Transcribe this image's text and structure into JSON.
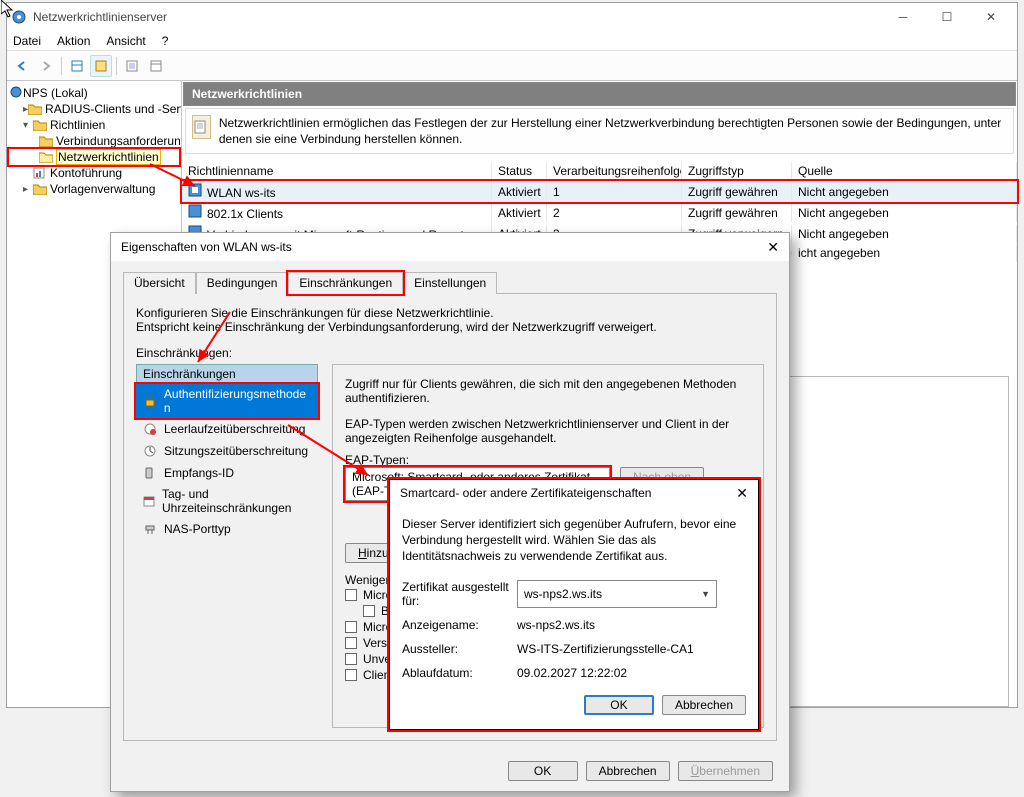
{
  "main": {
    "title": "Netzwerkrichtlinienserver",
    "menu": {
      "file": "Datei",
      "action": "Aktion",
      "view": "Ansicht",
      "help": "?"
    },
    "tree": {
      "root": "NPS (Lokal)",
      "radius": "RADIUS-Clients und -Serve",
      "policies": "Richtlinien",
      "conn_req": "Verbindungsanforderun",
      "net_pol": "Netzwerkrichtlinien",
      "accounting": "Kontoführung",
      "templates": "Vorlagenverwaltung"
    },
    "detail": {
      "heading": "Netzwerkrichtlinien",
      "desc": "Netzwerkrichtlinien ermöglichen das Festlegen der zur Herstellung einer Netzwerkverbindung berechtigten Personen sowie der Bedingungen, unter denen sie eine Verbindung herstellen können.",
      "cols": {
        "name": "Richtlinienname",
        "status": "Status",
        "order": "Verarbeitungsreihenfolge",
        "access": "Zugriffstyp",
        "source": "Quelle"
      },
      "rows": [
        {
          "name": "WLAN ws-its",
          "status": "Aktiviert",
          "order": "1",
          "access": "Zugriff gewähren",
          "source": "Nicht angegeben"
        },
        {
          "name": "802.1x Clients",
          "status": "Aktiviert",
          "order": "2",
          "access": "Zugriff gewähren",
          "source": "Nicht angegeben"
        },
        {
          "name": "Verbindungen mit Microsoft-Routing- und Remotezugriffsserver",
          "status": "Aktiviert",
          "order": "3",
          "access": "Zugriff verweigern",
          "source": "Nicht angegeben"
        },
        {
          "name": "",
          "status": "",
          "order": "",
          "access": "",
          "source": "icht angegeben"
        }
      ]
    }
  },
  "props": {
    "title": "Eigenschaften von WLAN ws-its",
    "tabs": {
      "overview": "Übersicht",
      "conditions": "Bedingungen",
      "constraints": "Einschränkungen",
      "settings": "Einstellungen"
    },
    "conf1": "Konfigurieren Sie die Einschränkungen für diese Netzwerkrichtlinie.",
    "conf2": "Entspricht keine Einschränkung der Verbindungsanforderung, wird der Netzwerkzugriff verweigert.",
    "constraints_lbl": "Einschränkungen:",
    "group_hdr": "Einschränkungen",
    "items": {
      "auth": "Authentifizierungsmethoden",
      "idle": "Leerlaufzeitüberschreitung",
      "sess": "Sitzungszeitüberschreitung",
      "called": "Empfangs-ID",
      "day": "Tag- und Uhrzeiteinschränkungen",
      "nas": "NAS-Porttyp"
    },
    "right": {
      "t1": "Zugriff nur für Clients gewähren, die sich mit den angegebenen Methoden authentifizieren.",
      "t2": "EAP-Typen werden zwischen Netzwerkrichtlinienserver und Client in der angezeigten Reihenfolge ausgehandelt.",
      "eap_lbl": "EAP-Typen:",
      "eap_sel": "Microsoft: Smartcard- oder anderes Zertifikat (EAP-TLS)",
      "up": "Nach oben",
      "add": "Hinzufügen",
      "less": "Weniger siche",
      "chk_mschap2": "Microsoft-/",
      "chk_mschap2b": "Benutze",
      "chk_mschap": "Microsoft-/",
      "chk_enc": "Verschlüss",
      "chk_unenc": "Unverschl",
      "chk_client": "Clientverb"
    },
    "ok": "OK",
    "cancel": "Abbrechen",
    "apply": "Übernehmen"
  },
  "cert": {
    "title": "Smartcard- oder andere Zertifikateigenschaften",
    "desc": "Dieser Server identifiziert sich gegenüber Aufrufern, bevor eine Verbindung hergestellt wird. Wählen Sie das als Identitätsnachweis zu verwendende Zertifikat aus.",
    "issued_to_lbl": "Zertifikat ausgestellt für:",
    "issued_to": "ws-nps2.ws.its",
    "friendly_lbl": "Anzeigename:",
    "friendly": "ws-nps2.ws.its",
    "issuer_lbl": "Aussteller:",
    "issuer": "WS-ITS-Zertifizierungsstelle-CA1",
    "expiry_lbl": "Ablaufdatum:",
    "expiry": "09.02.2027 12:22:02",
    "ok": "OK",
    "cancel": "Abbrechen"
  }
}
